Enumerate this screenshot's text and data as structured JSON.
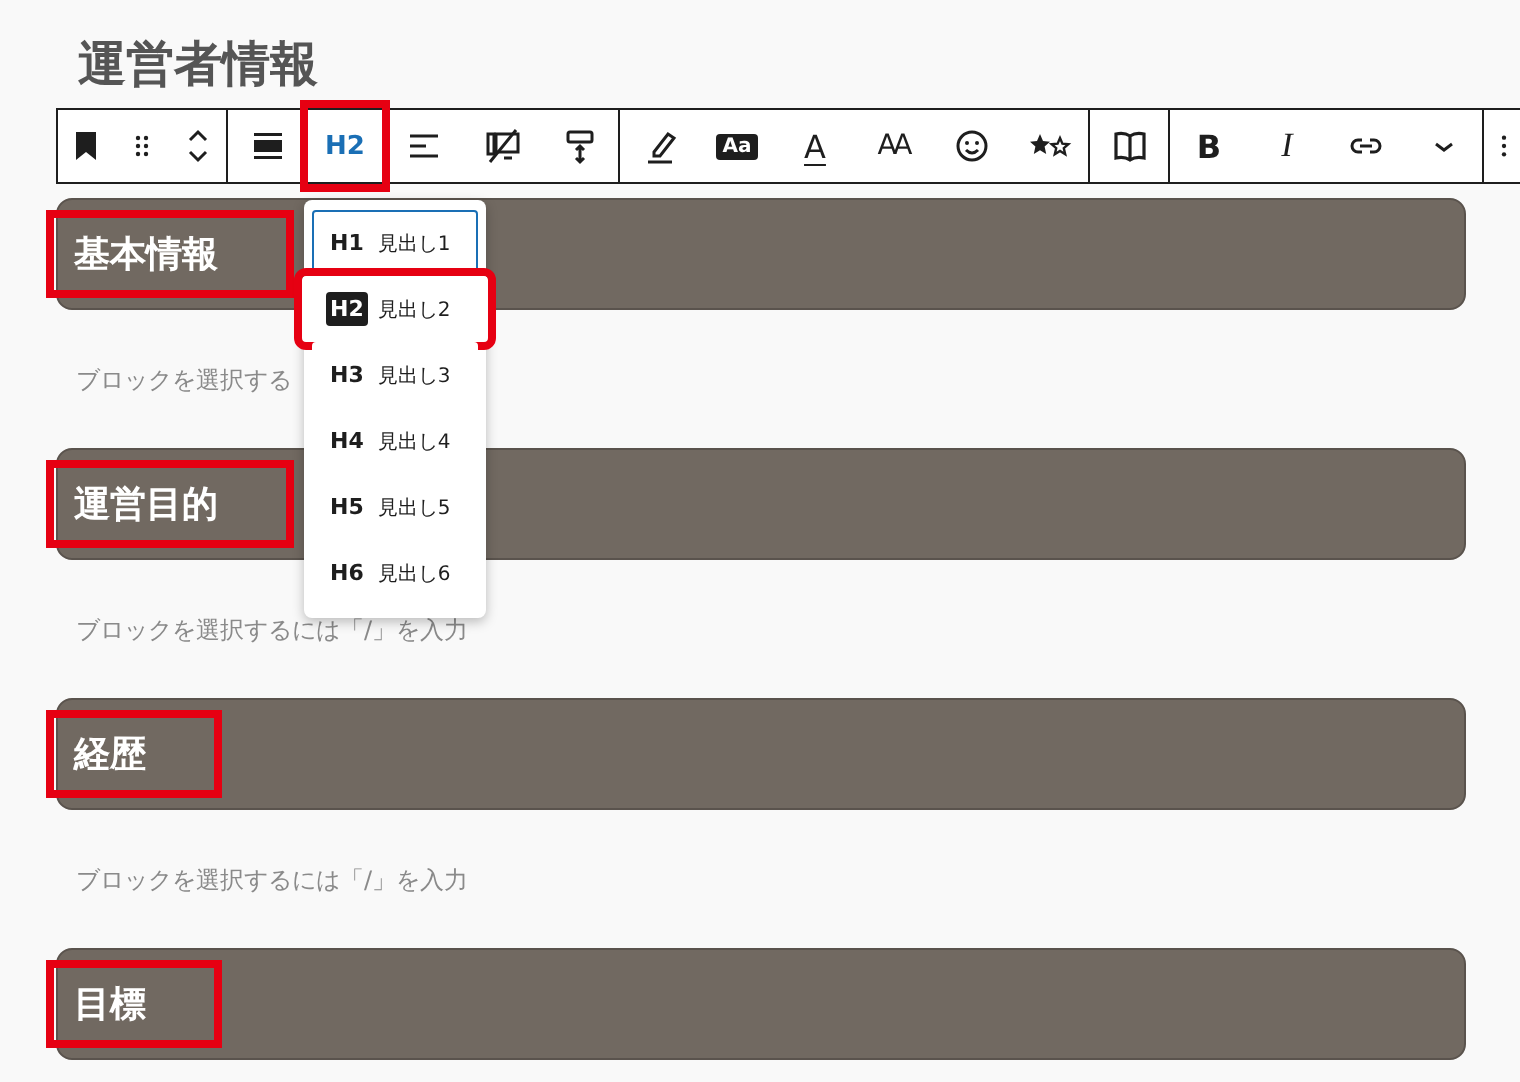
{
  "page_title": "運営者情報",
  "toolbar": {
    "groups": [
      {
        "items": [
          {
            "kind": "icon"
          },
          {
            "kind": "icon"
          },
          {
            "kind": "icon"
          }
        ]
      },
      {
        "items": [
          {
            "kind": "icon"
          },
          {
            "kind": "text",
            "label": "H2",
            "selected": true,
            "highlighted": true
          },
          {
            "kind": "icon"
          },
          {
            "kind": "icon"
          },
          {
            "kind": "icon"
          }
        ]
      },
      {
        "items": [
          {
            "kind": "icon"
          },
          {
            "kind": "badge",
            "label": "Aa"
          },
          {
            "kind": "underline",
            "label": "A"
          },
          {
            "kind": "size",
            "label": "AA"
          },
          {
            "kind": "icon"
          },
          {
            "kind": "icon"
          }
        ]
      },
      {
        "items": [
          {
            "kind": "icon"
          }
        ]
      },
      {
        "items": [
          {
            "kind": "bold",
            "label": "B"
          },
          {
            "kind": "italic",
            "label": "I"
          },
          {
            "kind": "icon"
          },
          {
            "kind": "icon"
          }
        ]
      },
      {
        "items": [
          {
            "kind": "icon"
          }
        ]
      }
    ]
  },
  "heading_menu": [
    {
      "level": "H1",
      "label": "見出し1",
      "selected": false,
      "focused": true,
      "highlighted": false
    },
    {
      "level": "H2",
      "label": "見出し2",
      "selected": true,
      "focused": false,
      "highlighted": true
    },
    {
      "level": "H3",
      "label": "見出し3",
      "selected": false,
      "focused": false,
      "highlighted": false
    },
    {
      "level": "H4",
      "label": "見出し4",
      "selected": false,
      "focused": false,
      "highlighted": false
    },
    {
      "level": "H5",
      "label": "見出し5",
      "selected": false,
      "focused": false,
      "highlighted": false
    },
    {
      "level": "H6",
      "label": "見出し6",
      "selected": false,
      "focused": false,
      "highlighted": false
    }
  ],
  "sections": [
    {
      "heading": "基本情報",
      "highlighted": true,
      "placeholder": "ブロックを選択する"
    },
    {
      "heading": "運営目的",
      "highlighted": true,
      "placeholder": "ブロックを選択するには「/」を入力"
    },
    {
      "heading": "経歴",
      "highlighted": true,
      "placeholder": "ブロックを選択するには「/」を入力"
    },
    {
      "heading": "目標",
      "highlighted": true
    }
  ]
}
